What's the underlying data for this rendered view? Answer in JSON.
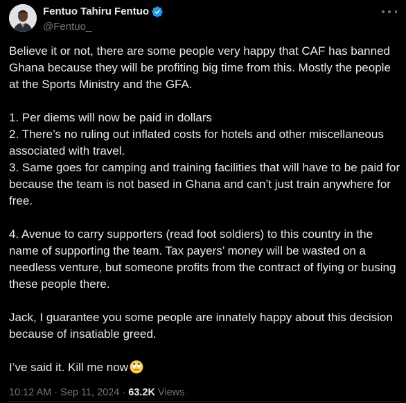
{
  "author": {
    "display_name": "Fentuo Tahiru Fentuo",
    "handle": "@Fentuo_",
    "verified_icon": "verified-badge-icon",
    "verified_color": "#1d9bf0"
  },
  "tweet": {
    "paragraph_1": "Believe it or not, there are some people very happy that CAF has banned Ghana because they will be profiting big time from this. Mostly the people at the Sports Ministry and the GFA.",
    "item_1": "1. Per diems will now be paid in dollars",
    "item_2": "2. There’s no ruling out inflated costs for hotels and other miscellaneous associated with travel.",
    "item_3": "3. Same goes for camping and training facilities that will have to be paid for because the team is not based in Ghana and can’t just train anywhere for free.",
    "item_4": "4. Avenue to carry supporters (read foot soldiers) to this country in the name of supporting the team. Tax payers’ money will be wasted on a needless venture, but someone profits from the contract of flying or busing these people there.",
    "paragraph_jack": "Jack, I guarantee you some people are innately happy about this decision because of insatiable greed.",
    "closing": "I’ve said it. Kill me now",
    "closing_emoji": "eye-roll-emoji-icon"
  },
  "meta": {
    "timestamp": "10:12 AM · Sep 11, 2024",
    "separator": " · ",
    "views_count": "63.2K",
    "views_label": "Views"
  },
  "colors": {
    "background": "#000000",
    "text": "#e7e9ea",
    "secondary_text": "#71767b"
  }
}
